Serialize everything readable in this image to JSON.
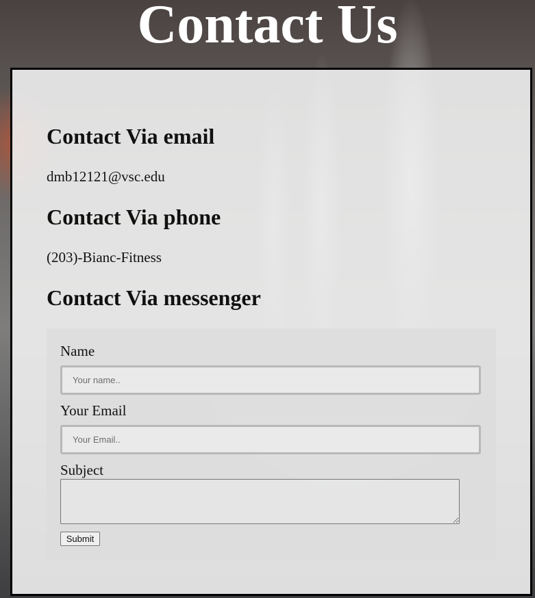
{
  "page": {
    "title": "Contact Us"
  },
  "contact": {
    "email_heading": "Contact Via email",
    "email_value": "dmb12121@vsc.edu",
    "phone_heading": "Contact Via phone",
    "phone_value": "(203)-Bianc-Fitness",
    "messenger_heading": "Contact Via messenger"
  },
  "form": {
    "name_label": "Name",
    "name_placeholder": "Your name..",
    "name_value": "",
    "email_label": "Your Email",
    "email_placeholder": "Your Email..",
    "email_value": "",
    "subject_label": "Subject",
    "subject_value": "",
    "submit_label": "Submit"
  }
}
